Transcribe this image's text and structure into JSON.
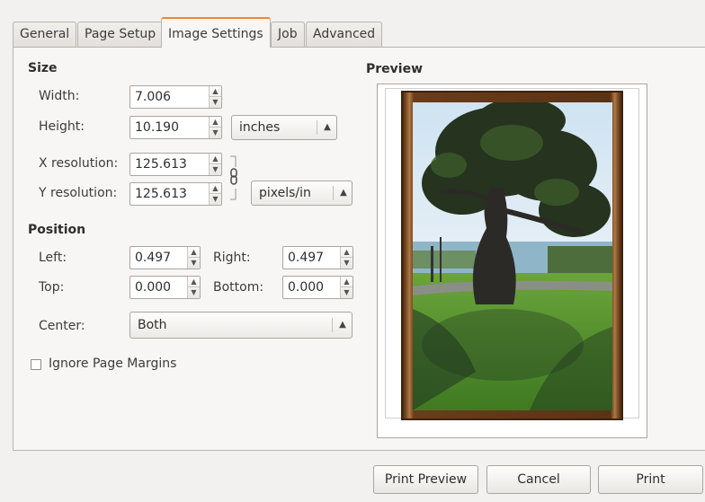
{
  "tabs": [
    {
      "label": "General",
      "active": false
    },
    {
      "label": "Page Setup",
      "active": false
    },
    {
      "label": "Image Settings",
      "active": true
    },
    {
      "label": "Job",
      "active": false
    },
    {
      "label": "Advanced",
      "active": false
    }
  ],
  "size": {
    "heading": "Size",
    "width_label": "Width:",
    "width_value": "7.006",
    "height_label": "Height:",
    "height_value": "10.190",
    "unit": "inches",
    "xres_label": "X resolution:",
    "xres_value": "125.613",
    "yres_label": "Y resolution:",
    "yres_value": "125.613",
    "res_unit": "pixels/in"
  },
  "position": {
    "heading": "Position",
    "left_label": "Left:",
    "left_value": "0.497",
    "right_label": "Right:",
    "right_value": "0.497",
    "top_label": "Top:",
    "top_value": "0.000",
    "bottom_label": "Bottom:",
    "bottom_value": "0.000",
    "center_label": "Center:",
    "center_value": "Both"
  },
  "ignore_margins": {
    "label": "Ignore Page Margins",
    "checked": false
  },
  "preview": {
    "heading": "Preview"
  },
  "buttons": {
    "print_preview": "Print Preview",
    "cancel": "Cancel",
    "print": "Print"
  },
  "icons": {
    "spin_up": "chevron-up-icon",
    "spin_down": "chevron-down-icon",
    "combo": "updown-arrows-icon",
    "chain": "chain-link-icon"
  },
  "colors": {
    "active_tab_accent": "#e8893a",
    "frame_wood": "#8a5a2e",
    "window_bg": "#f2f1f0"
  }
}
